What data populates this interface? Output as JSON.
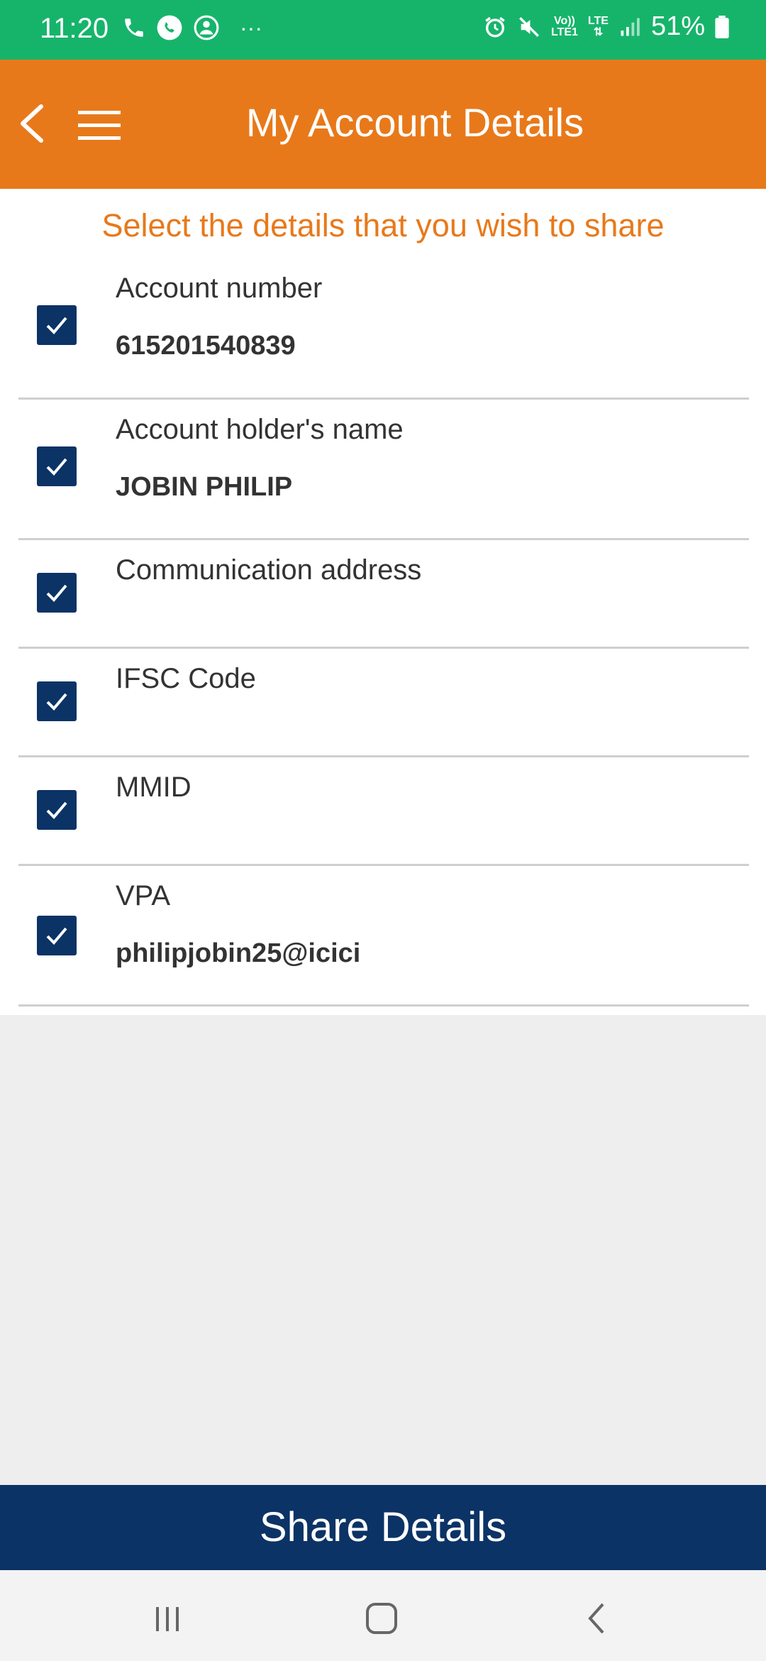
{
  "status_bar": {
    "time": "11:20",
    "more": "···",
    "volte": "Vo))",
    "lte1": "LTE1",
    "lte": "LTE",
    "battery": "51%"
  },
  "app_bar": {
    "title": "My Account Details",
    "back_icon": "chevron-left-icon",
    "menu_icon": "hamburger-icon"
  },
  "prompt": "Select the details that you wish to share",
  "items": [
    {
      "label": "Account number",
      "value": "615201540839",
      "checked": true
    },
    {
      "label": "Account holder's name",
      "value": "JOBIN PHILIP",
      "checked": true
    },
    {
      "label": "Communication address",
      "value": "",
      "checked": true
    },
    {
      "label": "IFSC Code",
      "value": "",
      "checked": true
    },
    {
      "label": "MMID",
      "value": "",
      "checked": true
    },
    {
      "label": "VPA",
      "value": "philipjobin25@icici",
      "checked": true
    }
  ],
  "share_button": "Share Details",
  "colors": {
    "status_bar": "#16b46b",
    "app_bar": "#e8791a",
    "accent_text": "#e8791a",
    "checkbox": "#0c3366",
    "share_button": "#0c3366"
  }
}
